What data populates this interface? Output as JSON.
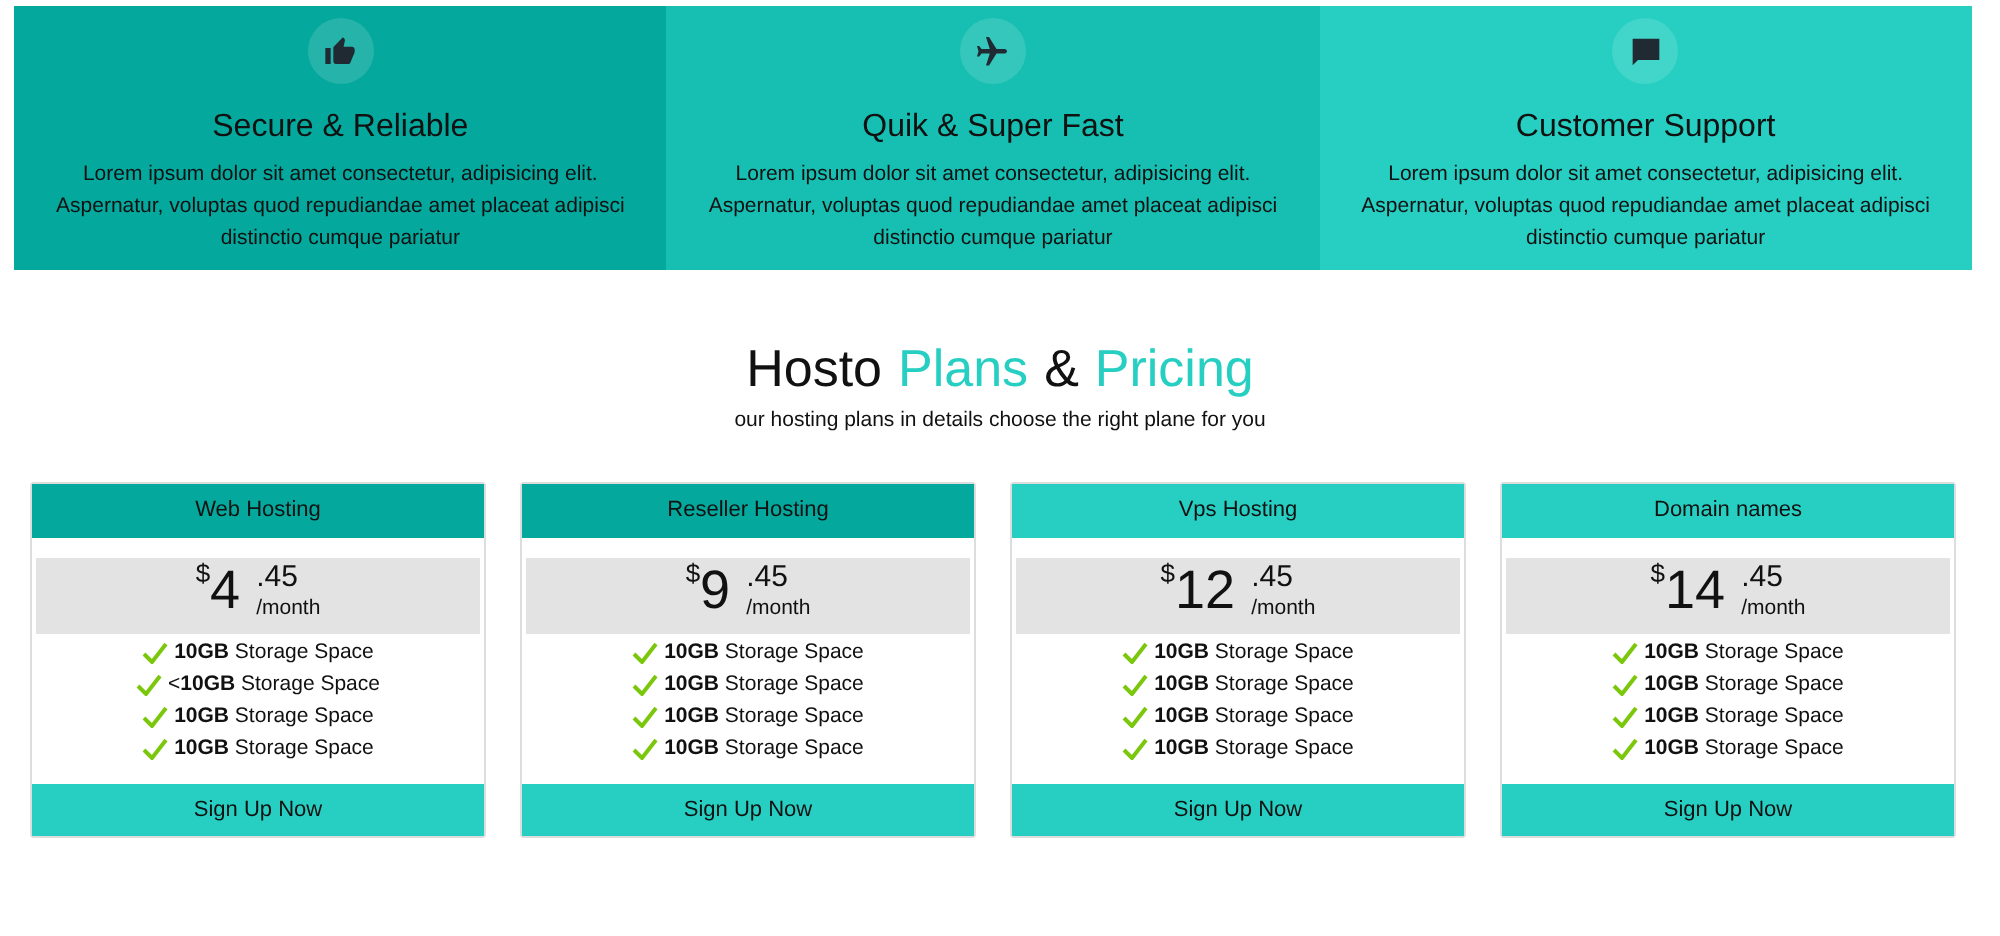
{
  "features": [
    {
      "title": "Secure & Reliable",
      "text": "Lorem ipsum dolor sit amet consectetur, adipisicing elit. Aspernatur, voluptas quod repudiandae amet placeat adipisci distinctio cumque pariatur",
      "color": "#05a89d"
    },
    {
      "title": "Quik & Super Fast",
      "text": "Lorem ipsum dolor sit amet consectetur, adipisicing elit. Aspernatur, voluptas quod repudiandae amet placeat adipisci distinctio cumque pariatur",
      "color": "#17bfb2"
    },
    {
      "title": "Customer Support",
      "text": "Lorem ipsum dolor sit amet consectetur, adipisicing elit. Aspernatur, voluptas quod repudiandae amet placeat adipisci distinctio cumque pariatur",
      "color": "#26cfc2"
    }
  ],
  "heading": {
    "parts": [
      {
        "text": "Hosto",
        "accent": false
      },
      {
        "text": "Plans",
        "accent": true
      },
      {
        "text": "&",
        "accent": false
      },
      {
        "text": "Pricing",
        "accent": true
      }
    ],
    "subtitle": "our hosting plans in details choose the right plane for you"
  },
  "plans": [
    {
      "name": "Web Hosting",
      "color": "#05a89d",
      "currency": "$",
      "amount": "4",
      "cents": ".45",
      "period": "/month",
      "features": [
        "**10GB** Storage Space",
        "<**10GB** Storage Space",
        "**10GB** Storage Space",
        "**10GB** Storage Space"
      ],
      "button": "Sign Up Now"
    },
    {
      "name": "Reseller Hosting",
      "color": "#05a89d",
      "currency": "$",
      "amount": "9",
      "cents": ".45",
      "period": "/month",
      "features": [
        "**10GB** Storage Space",
        "**10GB** Storage Space",
        "**10GB** Storage Space",
        "**10GB** Storage Space"
      ],
      "button": "Sign Up Now"
    },
    {
      "name": "Vps Hosting",
      "color": "#26cfc2",
      "currency": "$",
      "amount": "12",
      "cents": ".45",
      "period": "/month",
      "features": [
        "**10GB** Storage Space",
        "**10GB** Storage Space",
        "**10GB** Storage Space",
        "**10GB** Storage Space"
      ],
      "button": "Sign Up Now"
    },
    {
      "name": "Domain names",
      "color": "#26cfc2",
      "currency": "$",
      "amount": "14",
      "cents": ".45",
      "period": "/month",
      "features": [
        "**10GB** Storage Space",
        "**10GB** Storage Space",
        "**10GB** Storage Space",
        "**10GB** Storage Space"
      ],
      "button": "Sign Up Now"
    }
  ]
}
